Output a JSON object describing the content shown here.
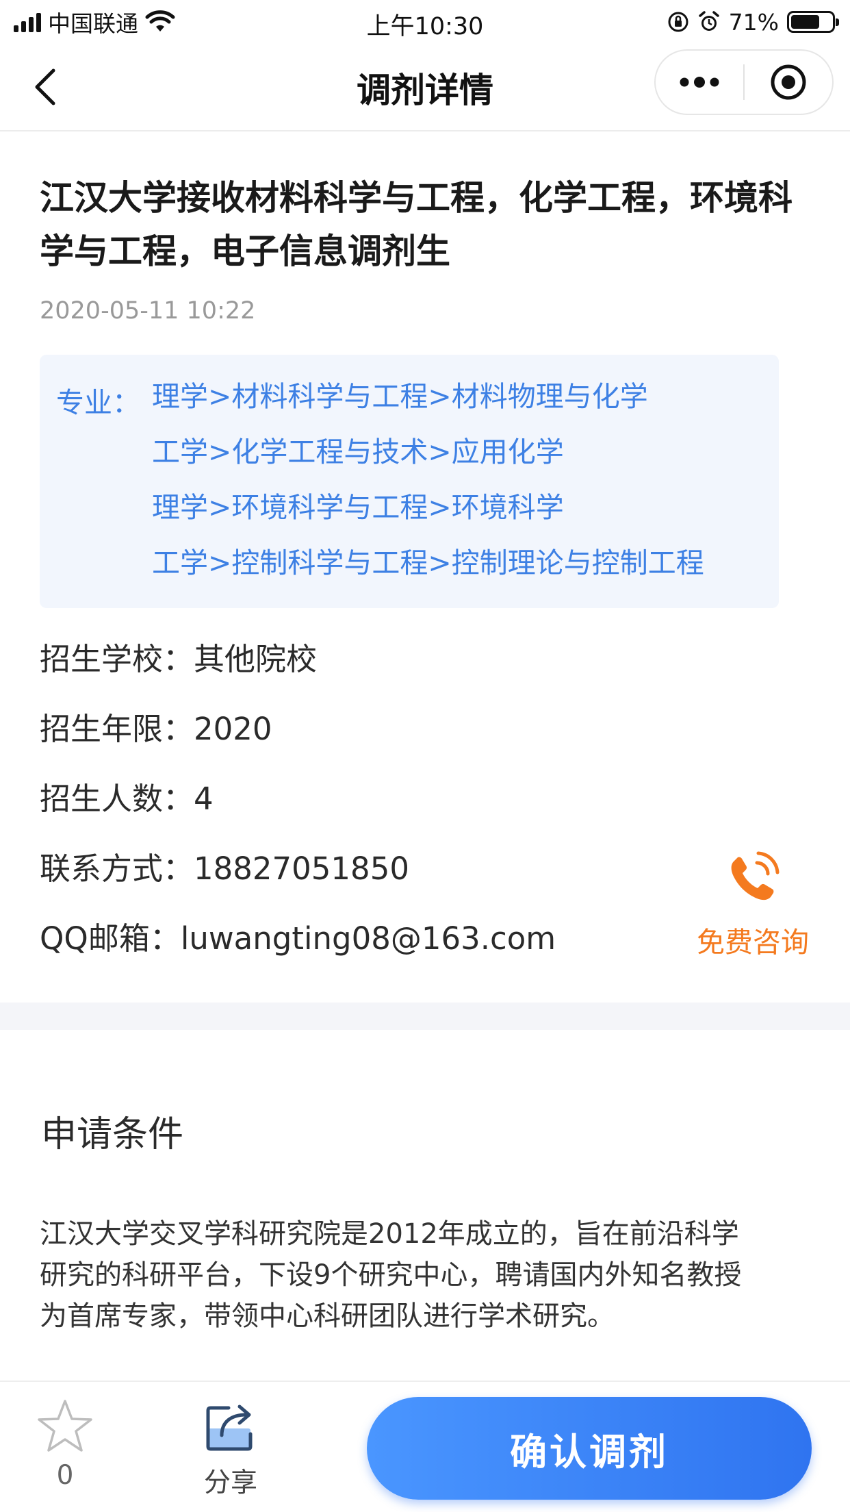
{
  "status_bar": {
    "carrier": "中国联通",
    "time": "上午10:30",
    "battery_pct": "71%",
    "battery_level": 0.71
  },
  "nav": {
    "title": "调剂详情",
    "back_icon": "chevron-left-icon",
    "more_icon": "more-dots-icon",
    "close_icon": "target-circle-icon"
  },
  "article": {
    "title": "江汉大学接收材料科学与工程，化学工程，环境科学与工程，电子信息调剂生",
    "date": "2020-05-11 10:22",
    "major_label": "专业：",
    "majors": [
      "理学>材料科学与工程>材料物理与化学",
      "工学>化学工程与技术>应用化学",
      "理学>环境科学与工程>环境科学",
      "工学>控制科学与工程>控制理论与控制工程"
    ],
    "info": [
      {
        "key": "招生学校：",
        "value": "其他院校"
      },
      {
        "key": "招生年限：",
        "value": "2020"
      },
      {
        "key": "招生人数：",
        "value": "4"
      },
      {
        "key": "联系方式：",
        "value": "18827051850"
      },
      {
        "key": "QQ邮箱：",
        "value": "luwangting08@163.com"
      }
    ],
    "consult_label": "免费咨询",
    "consult_icon": "phone-call-icon",
    "accent_orange": "#f47a1f",
    "accent_blue": "#3d80e4"
  },
  "conditions": {
    "title": "申请条件",
    "body_lines": [
      "江汉大学交叉学科研究院是2012年成立的，旨在前沿科学",
      "研究的科研平台，下设9个研究中心，聘请国内外知名教授",
      "为首席专家，带领中心科研团队进行学术研究。"
    ]
  },
  "bottom_bar": {
    "favorite_count": "0",
    "favorite_icon": "star-icon",
    "share_label": "分享",
    "share_icon": "share-icon",
    "confirm_label": "确认调剂"
  }
}
